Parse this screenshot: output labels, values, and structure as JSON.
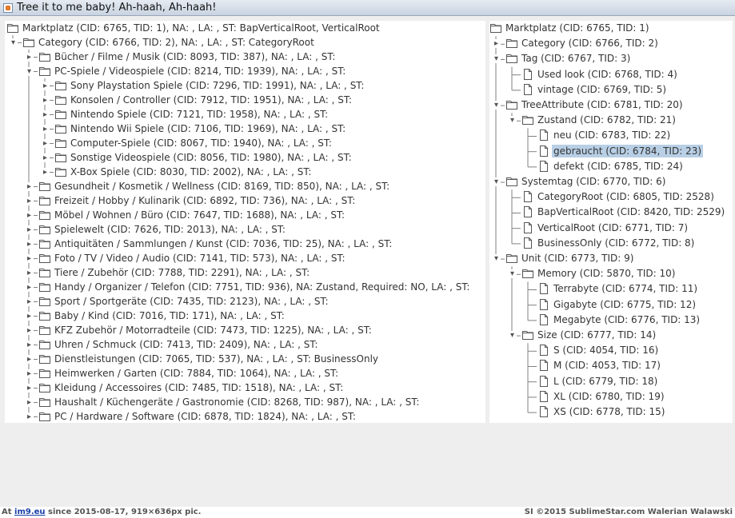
{
  "window": {
    "title": "Tree it to me baby! Ah-haah, Ah-haah!"
  },
  "colors": {
    "selection": "#b8cfe5",
    "titlebar": "#c9d3e1",
    "guide": "#808080"
  },
  "left_tree": [
    {
      "label": "Marktplatz (CID: 6765, TID: 1), NA: , LA: , ST: BapVerticalRoot, VerticalRoot",
      "depth": 0,
      "type": "folder",
      "state": "expanded"
    },
    {
      "label": "Category (CID: 6766, TID: 2), NA: , LA: , ST: CategoryRoot",
      "depth": 1,
      "type": "folder",
      "state": "expanded"
    },
    {
      "label": "Bücher / Filme / Musik (CID: 8093, TID: 387), NA: , LA: , ST:",
      "depth": 2,
      "type": "folder",
      "state": "collapsed"
    },
    {
      "label": "PC-Spiele  / Videospiele (CID: 8214, TID: 1939), NA: , LA: , ST:",
      "depth": 2,
      "type": "folder",
      "state": "expanded"
    },
    {
      "label": "Sony Playstation Spiele (CID: 7296, TID: 1991), NA: , LA: , ST:",
      "depth": 3,
      "type": "folder",
      "state": "collapsed"
    },
    {
      "label": "Konsolen / Controller (CID: 7912, TID: 1951), NA: , LA: , ST:",
      "depth": 3,
      "type": "folder",
      "state": "collapsed"
    },
    {
      "label": "Nintendo Spiele (CID: 7121, TID: 1958), NA: , LA: , ST:",
      "depth": 3,
      "type": "folder",
      "state": "collapsed"
    },
    {
      "label": "Nintendo Wii Spiele (CID: 7106, TID: 1969), NA: , LA: , ST:",
      "depth": 3,
      "type": "folder",
      "state": "collapsed"
    },
    {
      "label": "Computer-Spiele (CID: 8067, TID: 1940), NA: , LA: , ST:",
      "depth": 3,
      "type": "folder",
      "state": "collapsed"
    },
    {
      "label": "Sonstige Videospiele (CID: 8056, TID: 1980), NA: , LA: , ST:",
      "depth": 3,
      "type": "folder",
      "state": "collapsed"
    },
    {
      "label": "X-Box Spiele (CID: 8030, TID: 2002), NA: , LA: , ST:",
      "depth": 3,
      "type": "folder",
      "state": "collapsed"
    },
    {
      "label": "Gesundheit / Kosmetik / Wellness (CID: 8169, TID: 850), NA: , LA: , ST:",
      "depth": 2,
      "type": "folder",
      "state": "collapsed"
    },
    {
      "label": "Freizeit / Hobby / Kulinarik (CID: 6892, TID: 736), NA: , LA: , ST:",
      "depth": 2,
      "type": "folder",
      "state": "collapsed"
    },
    {
      "label": "Möbel / Wohnen / Büro (CID: 7647, TID: 1688), NA: , LA: , ST:",
      "depth": 2,
      "type": "folder",
      "state": "collapsed"
    },
    {
      "label": "Spielewelt (CID: 7626, TID: 2013), NA: , LA: , ST:",
      "depth": 2,
      "type": "folder",
      "state": "collapsed"
    },
    {
      "label": "Antiquitäten / Sammlungen / Kunst (CID: 7036, TID: 25), NA: , LA: , ST:",
      "depth": 2,
      "type": "folder",
      "state": "collapsed"
    },
    {
      "label": "Foto / TV / Video / Audio (CID: 7141, TID: 573), NA: , LA: , ST:",
      "depth": 2,
      "type": "folder",
      "state": "collapsed"
    },
    {
      "label": "Tiere / Zubehör (CID: 7788, TID: 2291), NA: , LA: , ST:",
      "depth": 2,
      "type": "folder",
      "state": "collapsed"
    },
    {
      "label": "Handy / Organizer / Telefon (CID: 7751, TID: 936), NA: Zustand, Required: NO, LA: , ST:",
      "depth": 2,
      "type": "folder",
      "state": "collapsed"
    },
    {
      "label": "Sport / Sportgeräte (CID: 7435, TID: 2123), NA: , LA: , ST:",
      "depth": 2,
      "type": "folder",
      "state": "collapsed"
    },
    {
      "label": "Baby / Kind (CID: 7016, TID: 171), NA: , LA: , ST:",
      "depth": 2,
      "type": "folder",
      "state": "collapsed"
    },
    {
      "label": "KFZ Zubehör / Motorradteile (CID: 7473, TID: 1225), NA: , LA: , ST:",
      "depth": 2,
      "type": "folder",
      "state": "collapsed"
    },
    {
      "label": "Uhren / Schmuck (CID: 7413, TID: 2409), NA: , LA: , ST:",
      "depth": 2,
      "type": "folder",
      "state": "collapsed"
    },
    {
      "label": "Dienstleistungen (CID: 7065, TID: 537), NA: , LA: , ST: BusinessOnly",
      "depth": 2,
      "type": "folder",
      "state": "collapsed"
    },
    {
      "label": "Heimwerken / Garten (CID: 7884, TID: 1064), NA: , LA: , ST:",
      "depth": 2,
      "type": "folder",
      "state": "collapsed"
    },
    {
      "label": "Kleidung / Accessoires (CID: 7485, TID: 1518), NA: , LA: , ST:",
      "depth": 2,
      "type": "folder",
      "state": "collapsed"
    },
    {
      "label": "Haushalt / Küchengeräte / Gastronomie (CID: 8268, TID: 987), NA: , LA: , ST:",
      "depth": 2,
      "type": "folder",
      "state": "collapsed"
    },
    {
      "label": "PC / Hardware / Software (CID: 6878, TID: 1824), NA: , LA: , ST:",
      "depth": 2,
      "type": "folder",
      "state": "collapsed"
    }
  ],
  "right_tree": [
    {
      "label": "Marktplatz (CID: 6765, TID: 1)",
      "depth": 0,
      "type": "folder",
      "state": "expanded"
    },
    {
      "label": "Category (CID: 6766, TID: 2)",
      "depth": 1,
      "type": "folder",
      "state": "collapsed"
    },
    {
      "label": "Tag (CID: 6767, TID: 3)",
      "depth": 1,
      "type": "folder",
      "state": "expanded"
    },
    {
      "label": "Used look (CID: 6768, TID: 4)",
      "depth": 2,
      "type": "file",
      "state": "leaf"
    },
    {
      "label": "vintage (CID: 6769, TID: 5)",
      "depth": 2,
      "type": "file",
      "state": "leaf"
    },
    {
      "label": "TreeAttribute (CID: 6781, TID: 20)",
      "depth": 1,
      "type": "folder",
      "state": "expanded"
    },
    {
      "label": "Zustand (CID: 6782, TID: 21)",
      "depth": 2,
      "type": "folder",
      "state": "expanded"
    },
    {
      "label": "neu (CID: 6783, TID: 22)",
      "depth": 3,
      "type": "file",
      "state": "leaf"
    },
    {
      "label": "gebraucht (CID: 6784, TID: 23)",
      "depth": 3,
      "type": "file",
      "state": "leaf",
      "selected": true
    },
    {
      "label": "defekt (CID: 6785, TID: 24)",
      "depth": 3,
      "type": "file",
      "state": "leaf"
    },
    {
      "label": "Systemtag (CID: 6770, TID: 6)",
      "depth": 1,
      "type": "folder",
      "state": "expanded"
    },
    {
      "label": "CategoryRoot (CID: 6805, TID: 2528)",
      "depth": 2,
      "type": "file",
      "state": "leaf"
    },
    {
      "label": "BapVerticalRoot (CID: 8420, TID: 2529)",
      "depth": 2,
      "type": "file",
      "state": "leaf"
    },
    {
      "label": "VerticalRoot (CID: 6771, TID: 7)",
      "depth": 2,
      "type": "file",
      "state": "leaf"
    },
    {
      "label": "BusinessOnly (CID: 6772, TID: 8)",
      "depth": 2,
      "type": "file",
      "state": "leaf"
    },
    {
      "label": "Unit (CID: 6773, TID: 9)",
      "depth": 1,
      "type": "folder",
      "state": "expanded"
    },
    {
      "label": "Memory (CID: 5870, TID: 10)",
      "depth": 2,
      "type": "folder",
      "state": "expanded"
    },
    {
      "label": "Terrabyte (CID: 6774, TID: 11)",
      "depth": 3,
      "type": "file",
      "state": "leaf"
    },
    {
      "label": "Gigabyte (CID: 6775, TID: 12)",
      "depth": 3,
      "type": "file",
      "state": "leaf"
    },
    {
      "label": "Megabyte (CID: 6776, TID: 13)",
      "depth": 3,
      "type": "file",
      "state": "leaf"
    },
    {
      "label": "Size (CID: 6777, TID: 14)",
      "depth": 2,
      "type": "folder",
      "state": "expanded"
    },
    {
      "label": "S (CID: 4054, TID: 16)",
      "depth": 3,
      "type": "file",
      "state": "leaf"
    },
    {
      "label": "M (CID: 4053, TID: 17)",
      "depth": 3,
      "type": "file",
      "state": "leaf"
    },
    {
      "label": "L (CID: 6779, TID: 18)",
      "depth": 3,
      "type": "file",
      "state": "leaf"
    },
    {
      "label": "XL (CID: 6780, TID: 19)",
      "depth": 3,
      "type": "file",
      "state": "leaf"
    },
    {
      "label": "XS (CID: 6778, TID: 15)",
      "depth": 3,
      "type": "file",
      "state": "leaf"
    }
  ],
  "status_bar": {
    "prefix": "At",
    "link": "im9.eu",
    "since": "since 2015-08-17, 919×636px pic.",
    "right": "SI ©2015 SublimeStar.com Walerian Walawski"
  }
}
